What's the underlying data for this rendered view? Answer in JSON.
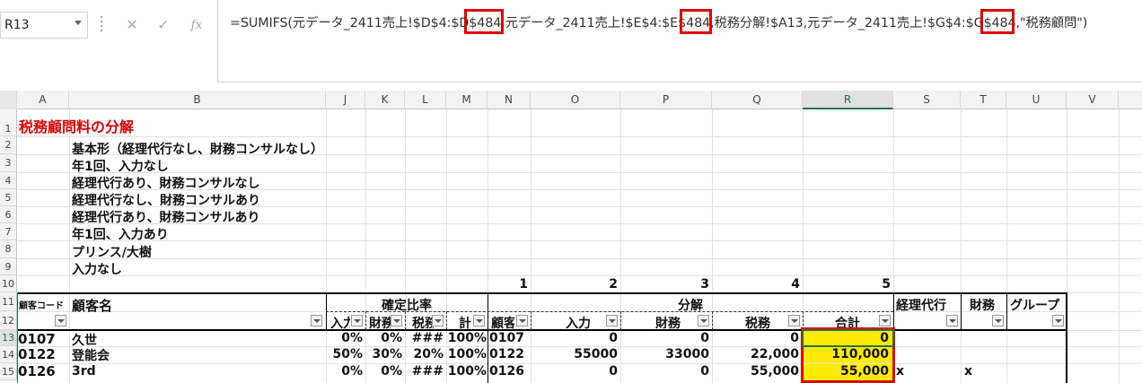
{
  "name_box": {
    "value": "R13"
  },
  "formula_bar": {
    "cancel_glyph": "✕",
    "enter_glyph": "✓",
    "fx_glyph": "fx",
    "formula_text": "=SUMIFS(元データ_2411売上!$D$4:$D$484,元データ_2411売上!$E$4:$E$484,税務分解!$A13,元データ_2411売上!$G$4:$G$484,\"税務顧問\")"
  },
  "selected_cell": {
    "column": "R",
    "row": "13"
  },
  "columns": [
    "A",
    "B",
    "J",
    "K",
    "L",
    "M",
    "N",
    "O",
    "P",
    "Q",
    "R",
    "S",
    "T",
    "U",
    "V"
  ],
  "rows": [
    "1",
    "2",
    "3",
    "4",
    "5",
    "6",
    "7",
    "8",
    "9",
    "10",
    "11",
    "12",
    "13",
    "14",
    "15"
  ],
  "sheet": {
    "title": "税務顧問料の分解",
    "list_items": [
      "基本形（経理代行なし、財務コンサルなし）",
      "年1回、入力なし",
      "経理代行あり、財務コンサルなし",
      "経理代行なし、財務コンサルあり",
      "経理代行あり、財務コンサルあり",
      "年1回、入力あり",
      "プリンス/大樹",
      "入力なし"
    ],
    "index_numbers": [
      "1",
      "2",
      "3",
      "4",
      "5"
    ],
    "headers": {
      "customer_code": "顧客コード",
      "customer_name": "顧客名",
      "confirmed_ratio": "確定比率",
      "breakdown": "分解",
      "accounting": "経理代行",
      "finance": "財務",
      "group": "グループ",
      "input_short": "入力",
      "finance_short": "財務",
      "tax_short": "税務",
      "total_short": "計",
      "code_short": "顧客",
      "input": "入力",
      "finance_col": "財務",
      "tax": "税務",
      "total": "合計"
    },
    "data_rows": [
      {
        "code": "0107",
        "name": "久世",
        "j": "0%",
        "k": "0%",
        "l": "###",
        "m": "100%",
        "n": "0107",
        "o": "0",
        "p": "0",
        "q": "0",
        "r": "0",
        "s": "",
        "t": ""
      },
      {
        "code": "0122",
        "name": "登能会",
        "j": "50%",
        "k": "30%",
        "l": "20%",
        "m": "100%",
        "n": "0122",
        "o": "55000",
        "p": "33000",
        "q": "22,000",
        "r": "110,000",
        "s": "",
        "t": ""
      },
      {
        "code": "0126",
        "name": "3rd",
        "j": "0%",
        "k": "0%",
        "l": "###",
        "m": "100%",
        "n": "0126",
        "o": "0",
        "p": "0",
        "q": "55,000",
        "r": "55,000",
        "s": "x",
        "t": "x"
      }
    ]
  },
  "colors": {
    "accent_red": "#e00000",
    "highlight_yellow": "#ffeb00",
    "excel_green": "#217346"
  }
}
